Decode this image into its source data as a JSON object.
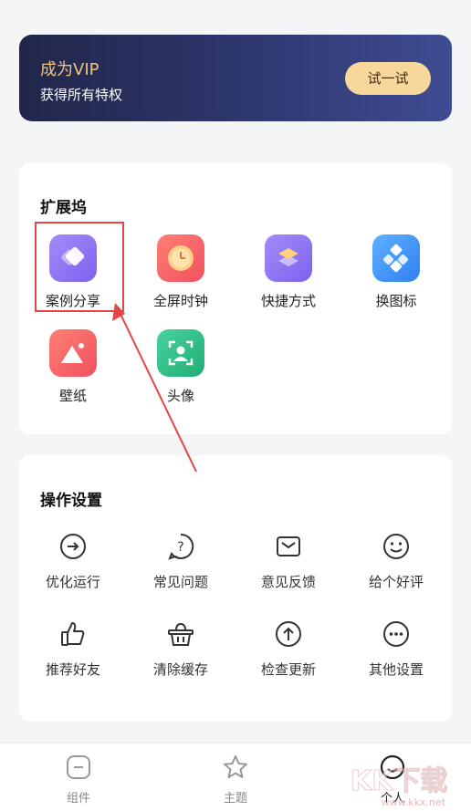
{
  "vip": {
    "title": "成为VIP",
    "subtitle": "获得所有特权",
    "button_label": "试一试"
  },
  "extensions": {
    "title": "扩展坞",
    "items": [
      {
        "label": "案例分享",
        "icon": "case-share-icon",
        "color": "#8b73f3"
      },
      {
        "label": "全屏时钟",
        "icon": "clock-icon",
        "color": "#f2646a"
      },
      {
        "label": "快捷方式",
        "icon": "shortcut-icon",
        "color": "#8b73f3"
      },
      {
        "label": "换图标",
        "icon": "change-icon-icon",
        "color": "#3d8ff0"
      },
      {
        "label": "壁纸",
        "icon": "wallpaper-icon",
        "color": "#f2646a"
      },
      {
        "label": "头像",
        "icon": "avatar-icon",
        "color": "#2fbe86"
      }
    ]
  },
  "operations": {
    "title": "操作设置",
    "items": [
      {
        "label": "优化运行",
        "icon": "optimize-icon"
      },
      {
        "label": "常见问题",
        "icon": "faq-icon"
      },
      {
        "label": "意见反馈",
        "icon": "feedback-icon"
      },
      {
        "label": "给个好评",
        "icon": "smile-icon"
      },
      {
        "label": "推荐好友",
        "icon": "thumbs-up-icon"
      },
      {
        "label": "清除缓存",
        "icon": "basket-icon"
      },
      {
        "label": "检查更新",
        "icon": "update-icon"
      },
      {
        "label": "其他设置",
        "icon": "more-icon"
      }
    ]
  },
  "nav": {
    "items": [
      {
        "label": "组件",
        "icon": "widget-icon"
      },
      {
        "label": "主题",
        "icon": "star-icon"
      },
      {
        "label": "个人",
        "icon": "profile-icon",
        "active": true
      }
    ]
  },
  "watermark": {
    "text": "www.kkx.net",
    "logo_text": "KK下载"
  }
}
